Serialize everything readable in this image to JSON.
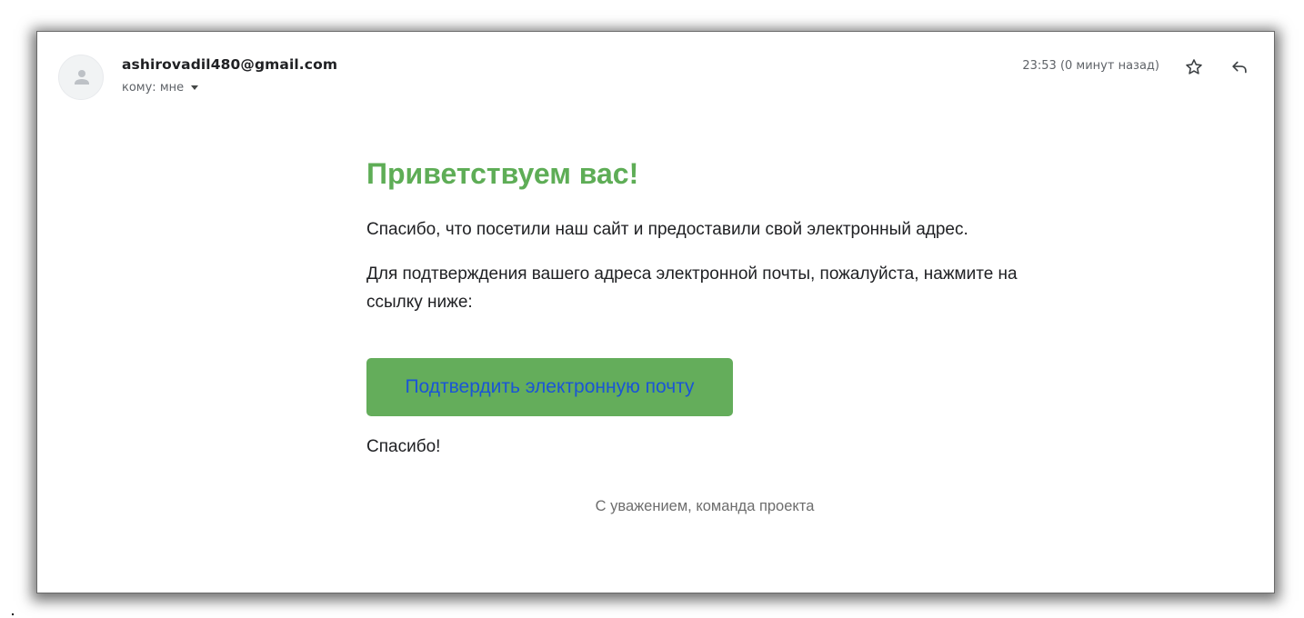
{
  "email": {
    "sender": "ashirovadil480@gmail.com",
    "recipient_label": "кому: мне",
    "timestamp": "23:53 (0 минут назад)"
  },
  "icons": {
    "avatar": "person-icon",
    "recipient_caret": "caret-down-icon",
    "star": "star-icon",
    "reply": "reply-icon"
  },
  "body": {
    "greeting": "Приветствуем вас!",
    "paragraph1": "Спасибо, что посетили наш сайт и предоставили свой электронный адрес.",
    "paragraph2": "Для подтверждения вашего адреса электронной почты, пожалуйста, нажмите на ссылку ниже:",
    "confirm_button": "Подтвердить электронную почту",
    "thanks": "Спасибо!",
    "signature": "С уважением, команда проекта"
  },
  "colors": {
    "greeting": "#5ead56",
    "button_background": "#64ad5b",
    "button_text": "#1a55d6"
  }
}
